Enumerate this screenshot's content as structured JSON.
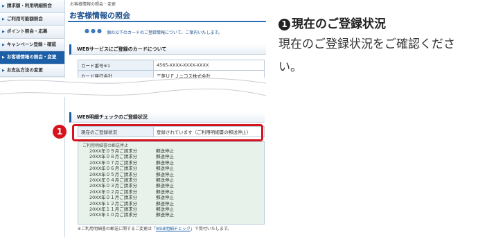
{
  "sidebar": {
    "items": [
      {
        "label": "請求額・利用明細照会",
        "active": false
      },
      {
        "label": "ご利用可能額照会",
        "active": false
      },
      {
        "label": "ポイント照会・応募",
        "active": false
      },
      {
        "label": "キャンペーン登録・確認",
        "active": false
      },
      {
        "label": "お客様情報の照会・変更",
        "active": true
      },
      {
        "label": "お支払方法の変更",
        "active": false
      }
    ]
  },
  "main": {
    "breadcrumb": "お客様情報の照会・変更",
    "page_title": "お客様情報の照会",
    "intro_dots": "●●●",
    "intro_text": "個の以下のカードのご登録情報について、ご案内いたします。",
    "card_section": {
      "heading": "WEBサービスにご登録のカードについて",
      "rows": [
        {
          "label": "カード番号※1",
          "value": "4565-XXXX-XXXX-XXXX"
        },
        {
          "label": "カード発行会社",
          "value": "三菱ＵＦＪニコス株式会社"
        }
      ]
    },
    "web_section": {
      "heading": "WEB明細チェックのご登録状況",
      "status_label": "現在のご登録状況",
      "status_value": "登録されています（ご利用明細書の郵送停止）",
      "month_header": "ご利用明細書の郵送停止",
      "months": [
        {
          "month": "20XX年０９月ご請求分",
          "status": "郵送停止"
        },
        {
          "month": "20XX年０８月ご請求分",
          "status": "郵送停止"
        },
        {
          "month": "20XX年０７月ご請求分",
          "status": "郵送停止"
        },
        {
          "month": "20XX年０６月ご請求分",
          "status": "郵送停止"
        },
        {
          "month": "20XX年０５月ご請求分",
          "status": "郵送停止"
        },
        {
          "month": "20XX年０４月ご請求分",
          "status": "郵送停止"
        },
        {
          "month": "20XX年０３月ご請求分",
          "status": "郵送停止"
        },
        {
          "month": "20XX年０２月ご請求分",
          "status": "郵送停止"
        },
        {
          "month": "20XX年０１月ご請求分",
          "status": "郵送停止"
        },
        {
          "month": "20XX年１２月ご請求分",
          "status": "郵送停止"
        },
        {
          "month": "20XX年１１月ご請求分",
          "status": "郵送停止"
        },
        {
          "month": "20XX年１０月ご請求分",
          "status": "郵送停止"
        }
      ],
      "footnote_pre": "※ご利用明細書の郵送に関するご変更は「",
      "footnote_link": "WEB明細チェック",
      "footnote_post": "」で受付いたします。"
    },
    "marker": "1"
  },
  "callout": {
    "number": "1",
    "title": "現在のご登録状況",
    "description": "現在のご登録状況をご確認ください。"
  },
  "colors": {
    "accent": "#1c5fa6",
    "highlight": "#d7141e",
    "month_bg": "#e7f3ea"
  }
}
